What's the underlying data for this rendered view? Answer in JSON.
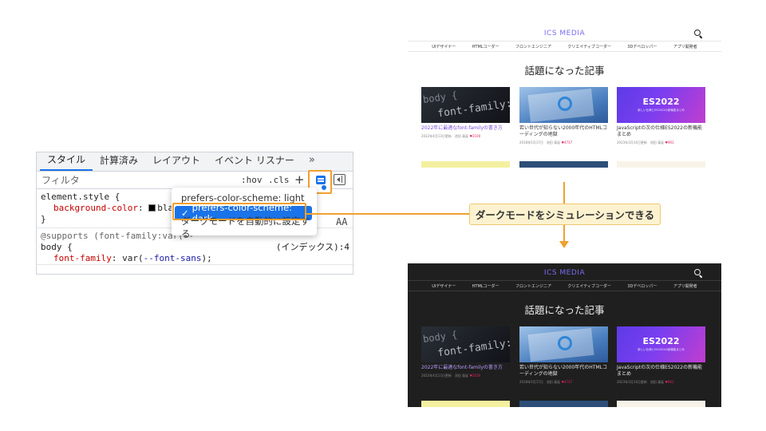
{
  "devtools": {
    "tabs": [
      "スタイル",
      "計算済み",
      "レイアウト",
      "イベント リスナー",
      "»"
    ],
    "filter_placeholder": "フィルタ",
    "hov_label": ":hov",
    "cls_label": ".cls",
    "plus_label": "+",
    "aa_label": "AA",
    "rules": {
      "element_style_selector": "element.style {",
      "element_style_prop": "background-color",
      "element_style_value": "black",
      "close_brace": "}",
      "supports_text": "@supports (font-family:var(--",
      "body_selector": "body {",
      "body_source": "(インデックス):4",
      "body_prop": "font-family",
      "body_value_prefix": "var(",
      "body_value_var": "--font-sans",
      "body_value_suffix": ");"
    },
    "menu": {
      "item_light": "prefers-color-scheme: light",
      "item_dark_check": "✓",
      "item_dark": "prefers-color-scheme: dark",
      "item_auto": "ダークモードを自動的に設定する"
    }
  },
  "callout": "ダークモードをシミュレーションできる",
  "site": {
    "logo": "ICS MEDIA",
    "nav": [
      "UIデザイナー",
      "HTMLコーダー",
      "フロントエンジニア",
      "クリエイティブコーダー",
      "3Dデベロッパー",
      "アプリ開発者"
    ],
    "heading": "話題になった記事",
    "cards": [
      {
        "thumb_text_a": "body {",
        "thumb_text_b": "font-family:",
        "title": "2022年に最適なfont-familyの書き方",
        "meta": "2022年4月13日更新　池田 泰延",
        "likes": "♥2100"
      },
      {
        "title": "若い世代が知らない2000年代のHTMLコーディングの地獄",
        "meta": "2018年5月17日　池田 泰延",
        "likes": "♥4737"
      },
      {
        "thumb_title": "ES2022",
        "thumb_sub": "新しい仕様とES2022の新機能まとめ",
        "title": "JavaScriptの次の仕様ES2022の新機能まとめ",
        "meta": "2023年3月14日更新　池田 泰延",
        "likes": "♥901"
      }
    ]
  },
  "colors": {
    "accent_orange": "#f0a030",
    "selection_blue": "#1a73e8",
    "callout_bg": "#fdf2d0",
    "dark_site_bg": "#1f1f1f"
  }
}
